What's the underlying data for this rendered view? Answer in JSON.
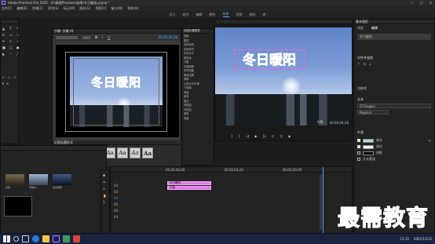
{
  "app": {
    "title": "Adobe Premiere Pro 2020 - D:\\精通Premiere\\效果\\冬日暖阳.prproj *",
    "window_controls": [
      "—",
      "□",
      "✕"
    ]
  },
  "menu": [
    "文件(F)",
    "编辑(E)",
    "剪辑(C)",
    "序列(S)",
    "标记(M)",
    "图形(G)",
    "视图(V)",
    "窗口(W)",
    "帮助(H)"
  ],
  "workspace_tabs": {
    "items": [
      "学习",
      "组件",
      "编辑",
      "颜色",
      "效果",
      "音频",
      "图形",
      "库"
    ],
    "active": "效果"
  },
  "legacy_title": {
    "panel_label": "字幕: 字幕 01",
    "title_text": "冬日暖阳",
    "styles_label": "旧版标题样式",
    "style_samples": [
      "Aa",
      "Aa",
      "Aa",
      "Aa",
      "Aa",
      "Aa",
      "Aa",
      "Aa"
    ],
    "props_label": "旧版标题属性",
    "props": [
      "变换",
      "属性",
      "字体系列",
      "字体样式",
      "字体大小",
      "宽高比",
      "行距",
      "字偶间距",
      "字符间距",
      "基线位移",
      "倾斜",
      "小型大写字母",
      "下划线",
      "扭曲",
      "填充",
      "描边",
      "内描边",
      "外描边",
      "阴影",
      "背景"
    ]
  },
  "program": {
    "title_text": "冬日暖阳",
    "fit_label": "完整",
    "timecode": "00;00;04;28",
    "zoom_label": "适合"
  },
  "right_panel": {
    "header": "基本图形",
    "tabs": [
      "浏览",
      "编辑"
    ],
    "layer_label": "冬日暖阳",
    "sections": [
      "对齐并变换",
      "主样式",
      "文本",
      "外观"
    ],
    "font": "STXingkai",
    "font_style": "Regular",
    "appearance": [
      "填充",
      "描边",
      "阴影",
      "文本蒙版"
    ],
    "colors": {
      "fill": "#a9dcec",
      "stroke": "#ffffff",
      "shadow": "#000000"
    }
  },
  "timeline": {
    "tracks": [
      "V3",
      "V2",
      "V1",
      "A1",
      "A2",
      "A3"
    ],
    "clips": [
      "冬日暖阳",
      "字幕"
    ],
    "timecodes": [
      "00;00;00;00",
      "00;00;04;29",
      "00;00;09;29"
    ]
  },
  "project": {
    "items": [
      "背景",
      "字幕01",
      "冬日暖阳"
    ]
  },
  "taskbar": {
    "time": "15:15",
    "date": "2021/11/12"
  },
  "watermark": {
    "text": "最需教育"
  }
}
